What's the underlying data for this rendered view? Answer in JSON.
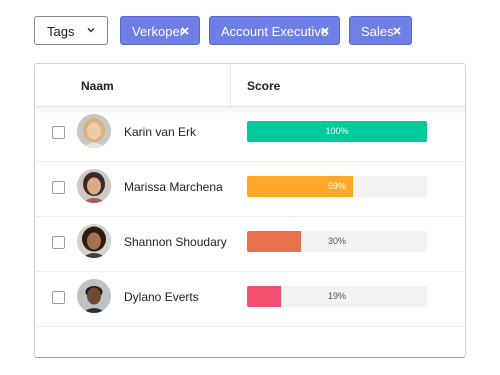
{
  "filter": {
    "select_label": "Tags",
    "chevron_icon": "chevron-down-icon",
    "tags": [
      {
        "label": "Verkoper",
        "remove_icon": "close-icon"
      },
      {
        "label": "Account Executive",
        "remove_icon": "close-icon"
      },
      {
        "label": "Sales",
        "remove_icon": "close-icon"
      }
    ],
    "tag_color": "#6f7fe5"
  },
  "table": {
    "columns": {
      "name": "Naam",
      "score": "Score"
    },
    "rows": [
      {
        "name": "Karin van Erk",
        "score": 100,
        "score_label": "100%",
        "bar_color": "#00c99a",
        "checked": false
      },
      {
        "name": "Marissa Marchena",
        "score": 59,
        "score_label": "59%",
        "bar_color": "#ffa827",
        "checked": false
      },
      {
        "name": "Shannon Shoudary",
        "score": 30,
        "score_label": "30%",
        "bar_color": "#e8704a",
        "checked": false
      },
      {
        "name": "Dylano Everts",
        "score": 19,
        "score_label": "19%",
        "bar_color": "#f2506e",
        "checked": false
      }
    ]
  }
}
